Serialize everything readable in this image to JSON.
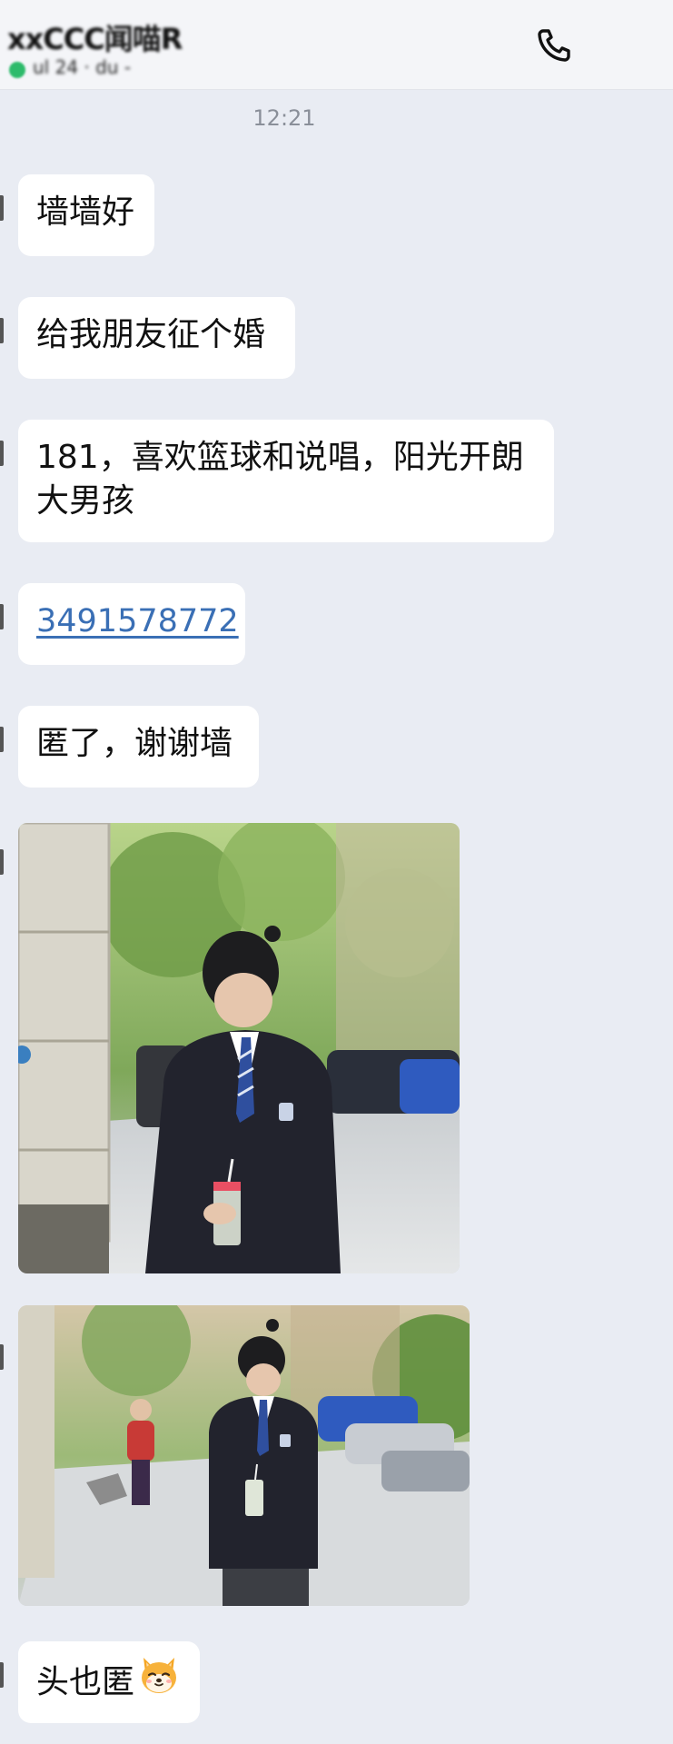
{
  "header": {
    "contact_name": "xxCCC闻喵R",
    "contact_status": "ul 24 · du -",
    "call_icon": "phone-icon"
  },
  "timestamp": "12:21",
  "messages": [
    {
      "type": "text",
      "text": "墙墙好"
    },
    {
      "type": "text",
      "text": "给我朋友征个婚"
    },
    {
      "type": "text",
      "lines": [
        "181，喜欢篮球和说唱，阳光开朗",
        "大男孩"
      ]
    },
    {
      "type": "link",
      "text": "3491578772"
    },
    {
      "type": "text",
      "text": "匿了，谢谢墙"
    },
    {
      "type": "image",
      "description": "photo of a young man in a school blazer holding a drink on a street"
    },
    {
      "type": "image",
      "description": "wider photo of the same young man walking on a tree-lined street"
    },
    {
      "type": "text_with_emoji",
      "text": "头也匿",
      "emoji": "shiba-dog-face-icon"
    }
  ],
  "colors": {
    "background": "#e9ecf3",
    "bubble": "#ffffff",
    "link": "#3a6fb5",
    "timestamp": "#8a8f99",
    "online": "#2dbb6b"
  }
}
